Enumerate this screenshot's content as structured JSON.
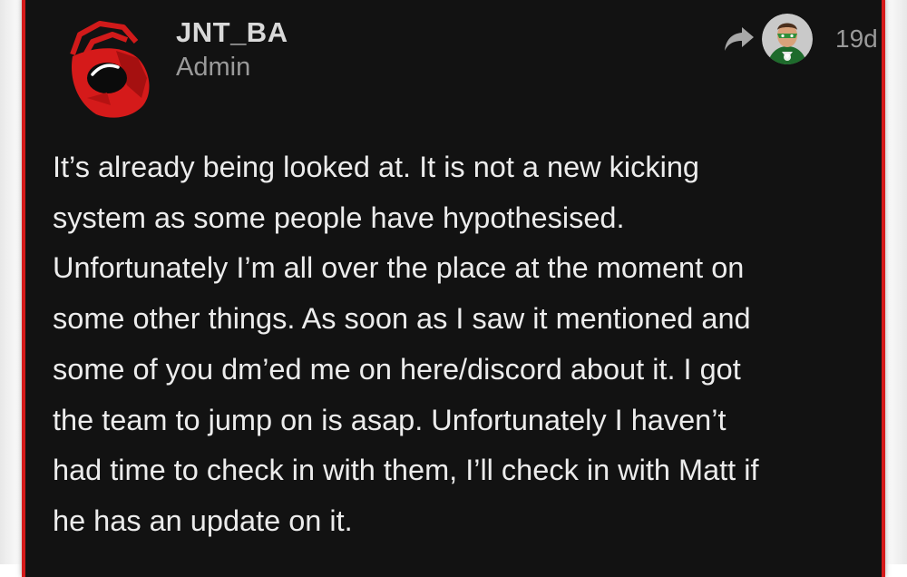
{
  "post": {
    "author": {
      "username": "JNT_BA",
      "title": "Admin",
      "avatar_icon": "red-helmet-logo-icon"
    },
    "meta": {
      "reply_icon": "reply-arrow-icon",
      "reply_to_avatar_icon": "user-avatar-green-lantern-icon",
      "date": "19d"
    },
    "body_lines": [
      "It’s already being looked at. It is not a new kicking",
      "system as some people have hypothesised.",
      "Unfortunately I’m all over the place at the moment on",
      "some other things. As soon as I saw it mentioned and",
      "some of you dm’ed me on here/discord about it. I got",
      "the team to jump on is asap. Unfortunately I haven’t",
      "had time to check in with them, I’ll check in with Matt if",
      "he has an update on it."
    ]
  },
  "colors": {
    "background": "#121212",
    "accent_border": "#d51a1a",
    "username": "#d9d9d9",
    "muted": "#9a9a9a",
    "body_text": "#ececec"
  }
}
